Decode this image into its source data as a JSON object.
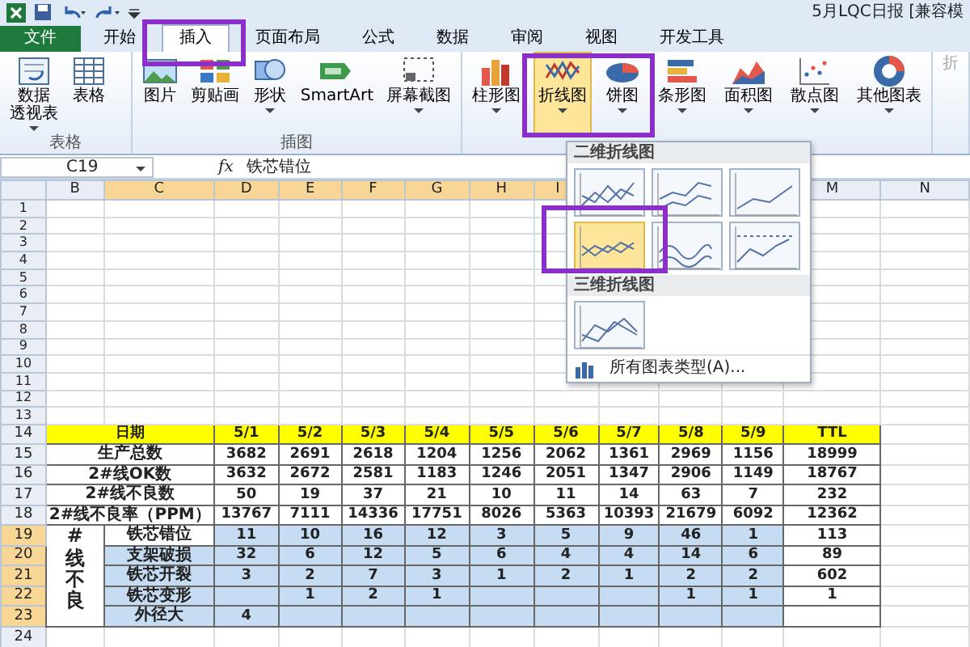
{
  "title_bar": {
    "title": "5月LQC日报  [兼容模"
  },
  "tabs": [
    {
      "label": "文件",
      "kind": "file",
      "selected": false
    },
    {
      "label": "开始",
      "kind": "tab",
      "selected": false
    },
    {
      "label": "插入",
      "kind": "tab",
      "selected": true
    },
    {
      "label": "页面布局",
      "kind": "tab",
      "selected": false
    },
    {
      "label": "公式",
      "kind": "tab",
      "selected": false
    },
    {
      "label": "数据",
      "kind": "tab",
      "selected": false
    },
    {
      "label": "审阅",
      "kind": "tab",
      "selected": false
    },
    {
      "label": "视图",
      "kind": "tab",
      "selected": false
    },
    {
      "label": "开发工具",
      "kind": "tab",
      "selected": false
    }
  ],
  "ribbon": {
    "groups": [
      {
        "label": "表格",
        "items": [
          {
            "lines": [
              "数据",
              "透视表"
            ],
            "dropdown": true,
            "selected": false
          },
          {
            "lines": [
              "表格"
            ],
            "dropdown": false,
            "selected": false
          }
        ]
      },
      {
        "label": "插图",
        "items": [
          {
            "lines": [
              "图片"
            ],
            "dropdown": false,
            "selected": false
          },
          {
            "lines": [
              "剪贴画"
            ],
            "dropdown": false,
            "selected": false
          },
          {
            "lines": [
              "形状"
            ],
            "dropdown": true,
            "selected": false
          },
          {
            "lines": [
              "SmartArt"
            ],
            "dropdown": false,
            "selected": false
          },
          {
            "lines": [
              "屏幕截图"
            ],
            "dropdown": true,
            "selected": false
          }
        ]
      },
      {
        "items": [
          {
            "lines": [
              "柱形图"
            ],
            "dropdown": true,
            "selected": false
          },
          {
            "lines": [
              "折线图"
            ],
            "dropdown": true,
            "selected": true
          },
          {
            "lines": [
              "饼图"
            ],
            "dropdown": true,
            "selected": false
          },
          {
            "lines": [
              "条形图"
            ],
            "dropdown": true,
            "selected": false
          },
          {
            "lines": [
              "面积图"
            ],
            "dropdown": true,
            "selected": false
          },
          {
            "lines": [
              "散点图"
            ],
            "dropdown": true,
            "selected": false
          },
          {
            "lines": [
              "其他图表"
            ],
            "dropdown": true,
            "selected": false
          }
        ]
      },
      {
        "items": [
          {
            "lines": [
              "折"
            ],
            "dropdown": false,
            "selected": false,
            "disabled": true
          }
        ]
      }
    ]
  },
  "formula_bar": {
    "name_box": "C19",
    "function_label": "fx",
    "formula": "铁芯错位"
  },
  "sheet": {
    "column_headers": [
      {
        "label": "B",
        "selected": false
      },
      {
        "label": "C",
        "selected": true
      },
      {
        "label": "D",
        "selected": true
      },
      {
        "label": "E",
        "selected": true
      },
      {
        "label": "F",
        "selected": true
      },
      {
        "label": "G",
        "selected": true
      },
      {
        "label": "H",
        "selected": true
      },
      {
        "label": "I",
        "selected": true
      },
      {
        "label": "M",
        "selected": false
      },
      {
        "label": "N",
        "selected": false
      }
    ],
    "row_headers": [
      {
        "label": "1",
        "selected": false
      },
      {
        "label": "2",
        "selected": false
      },
      {
        "label": "3",
        "selected": false
      },
      {
        "label": "4",
        "selected": false
      },
      {
        "label": "5",
        "selected": false
      },
      {
        "label": "6",
        "selected": false
      },
      {
        "label": "7",
        "selected": false
      },
      {
        "label": "8",
        "selected": false
      },
      {
        "label": "9",
        "selected": false
      },
      {
        "label": "10",
        "selected": false
      },
      {
        "label": "11",
        "selected": false
      },
      {
        "label": "12",
        "selected": false
      },
      {
        "label": "13",
        "selected": false
      },
      {
        "label": "14",
        "selected": false
      },
      {
        "label": "15",
        "selected": false
      },
      {
        "label": "16",
        "selected": false
      },
      {
        "label": "17",
        "selected": false
      },
      {
        "label": "18",
        "selected": false
      },
      {
        "label": "19",
        "selected": true
      },
      {
        "label": "20",
        "selected": true
      },
      {
        "label": "21",
        "selected": true
      },
      {
        "label": "22",
        "selected": true
      },
      {
        "label": "23",
        "selected": true
      },
      {
        "label": "24",
        "selected": false
      }
    ],
    "table": {
      "header": {
        "label": "日期",
        "dates": [
          "5/1",
          "5/2",
          "5/3",
          "5/4",
          "5/5",
          "5/6",
          "5/7",
          "5/8",
          "5/9"
        ],
        "total": "TTL"
      },
      "summary_rows": [
        {
          "label": "生产总数",
          "values": [
            "3682",
            "2691",
            "2618",
            "1204",
            "1256",
            "2062",
            "1361",
            "2969",
            "1156"
          ],
          "total": "18999"
        },
        {
          "label": "2#线OK数",
          "values": [
            "3632",
            "2672",
            "2581",
            "1183",
            "1246",
            "2051",
            "1347",
            "2906",
            "1149"
          ],
          "total": "18767"
        },
        {
          "label": "2#线不良数",
          "values": [
            "50",
            "19",
            "37",
            "21",
            "10",
            "11",
            "14",
            "63",
            "7"
          ],
          "total": "232"
        },
        {
          "label": "2#线不良率（PPM）",
          "values": [
            "13767",
            "7111",
            "14336",
            "17751",
            "8026",
            "5363",
            "10393",
            "21679",
            "6092"
          ],
          "total": "12362"
        }
      ],
      "defect_group": {
        "label": "#线不良",
        "rows": [
          {
            "label": "铁芯错位",
            "selected": false,
            "values": [
              {
                "text": "11",
                "selected": true
              },
              {
                "text": "10",
                "selected": true
              },
              {
                "text": "16",
                "selected": true
              },
              {
                "text": "12",
                "selected": true
              },
              {
                "text": "3",
                "selected": true
              },
              {
                "text": "5",
                "selected": true
              },
              {
                "text": "9",
                "selected": true
              },
              {
                "text": "46",
                "selected": true
              },
              {
                "text": "1",
                "selected": true
              }
            ],
            "total": "113"
          },
          {
            "label": "支架破损",
            "selected": true,
            "values": [
              {
                "text": "32",
                "selected": true
              },
              {
                "text": "6",
                "selected": true
              },
              {
                "text": "12",
                "selected": true
              },
              {
                "text": "5",
                "selected": true
              },
              {
                "text": "6",
                "selected": true
              },
              {
                "text": "4",
                "selected": true
              },
              {
                "text": "4",
                "selected": true
              },
              {
                "text": "14",
                "selected": true
              },
              {
                "text": "6",
                "selected": true
              }
            ],
            "total": "89"
          },
          {
            "label": "铁芯开裂",
            "selected": true,
            "values": [
              {
                "text": "3",
                "selected": true
              },
              {
                "text": "2",
                "selected": true
              },
              {
                "text": "7",
                "selected": true
              },
              {
                "text": "3",
                "selected": true
              },
              {
                "text": "1",
                "selected": true
              },
              {
                "text": "2",
                "selected": true
              },
              {
                "text": "1",
                "selected": true
              },
              {
                "text": "2",
                "selected": true
              },
              {
                "text": "2",
                "selected": true
              }
            ],
            "total": "602"
          },
          {
            "label": "铁芯变形",
            "selected": true,
            "values": [
              {
                "selected": true
              },
              {
                "text": "1",
                "selected": true
              },
              {
                "text": "2",
                "selected": true
              },
              {
                "text": "1",
                "selected": true
              },
              {
                "selected": true
              },
              {
                "selected": true
              },
              {
                "selected": true
              },
              {
                "text": "1",
                "selected": true
              },
              {
                "text": "1",
                "selected": true
              }
            ],
            "total": "1"
          },
          {
            "label": "外径大",
            "selected": true,
            "values": [
              {
                "text": "4",
                "selected": true
              },
              {
                "selected": true
              },
              {
                "selected": true
              },
              {
                "selected": true
              },
              {
                "selected": true
              },
              {
                "selected": true
              },
              {
                "selected": true
              },
              {
                "selected": true
              },
              {
                "selected": true
              }
            ]
          }
        ]
      }
    }
  },
  "gallery": {
    "sections": [
      {
        "title": "二维折线图",
        "items": [
          {
            "selected": false
          },
          {
            "selected": false
          },
          {
            "selected": false
          },
          {
            "selected": true
          },
          {
            "selected": false
          },
          {
            "selected": false
          }
        ]
      },
      {
        "title": "三维折线图",
        "items": [
          {
            "selected": false
          }
        ]
      }
    ],
    "footer": "所有图表类型(A)..."
  }
}
